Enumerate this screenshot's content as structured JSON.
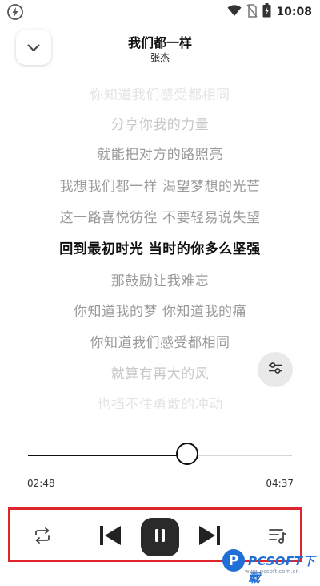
{
  "status_bar": {
    "time": "10:08"
  },
  "header": {
    "title": "我们都一样",
    "artist": "张杰"
  },
  "lyrics": {
    "lines": [
      {
        "text": "你知道我们感受都相同",
        "state": "fade"
      },
      {
        "text": "分享你我的力量",
        "state": "dim"
      },
      {
        "text": "就能把对方的路照亮",
        "state": "normal"
      },
      {
        "text": "我想我们都一样 渴望梦想的光芒",
        "state": "normal"
      },
      {
        "text": "这一路喜悦彷徨 不要轻易说失望",
        "state": "normal"
      },
      {
        "text": "回到最初时光 当时的你多么坚强",
        "state": "active"
      },
      {
        "text": "那鼓励让我难忘",
        "state": "normal"
      },
      {
        "text": "你知道我的梦 你知道我的痛",
        "state": "normal"
      },
      {
        "text": "你知道我们感受都相同",
        "state": "normal"
      },
      {
        "text": "就算有再大的风",
        "state": "dim"
      },
      {
        "text": "也挡不住勇敢的冲动",
        "state": "fade"
      }
    ]
  },
  "player": {
    "current_time": "02:48",
    "total_time": "04:37",
    "progress": 0.6065
  },
  "watermark": {
    "text": "PCSOFT下载",
    "sub": "www.pcsoft.com.cn"
  },
  "colors": {
    "accent": "#111111",
    "highlight_box": "#e0242b",
    "watermark": "#1f6fd6"
  }
}
